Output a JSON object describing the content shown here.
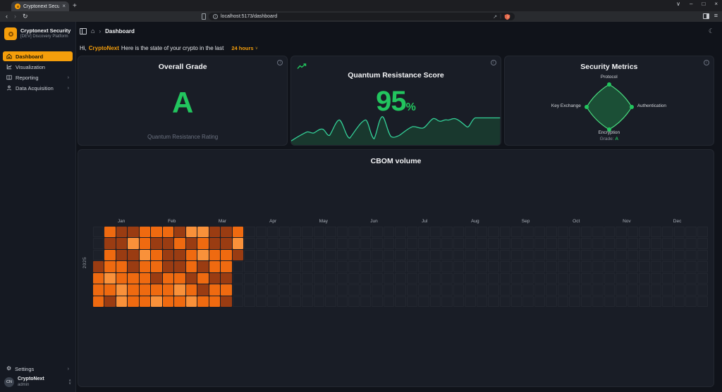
{
  "browser": {
    "tab_title": "Cryptonext Security",
    "url": "localhost:5173/dashboard"
  },
  "icons": {
    "back": "‹",
    "forward": "›",
    "reload": "↻",
    "plus": "+",
    "close": "×",
    "minimize": "–",
    "maximize": "□",
    "window_chevron": "∨",
    "menu": "≡",
    "share": "↗",
    "divider": "|",
    "home": "⌂",
    "breadcrumb_sep": "›",
    "moon": "☾",
    "chevron_right": "›",
    "chevron_down": "∨",
    "chevron_up": "∧",
    "info": "i",
    "gear": "⚙"
  },
  "sidebar": {
    "app_name": "Cryptonext Security",
    "app_subtitle": "[DEV] Discovery Platform",
    "items": [
      {
        "label": "Dashboard",
        "active": true
      },
      {
        "label": "Visualization",
        "active": false
      },
      {
        "label": "Reporting",
        "active": false
      },
      {
        "label": "Data Acquisition",
        "active": false
      }
    ],
    "settings_label": "Settings",
    "user": {
      "initials": "CN",
      "name": "CryptoNext",
      "role": "admin"
    }
  },
  "topbar": {
    "breadcrumb": "Dashboard"
  },
  "greeting": {
    "prefix": "Hi,",
    "username": "CryptoNext",
    "message": "Here is the state of your crypto in the last",
    "range": "24 hours"
  },
  "cards": {
    "overall_grade": {
      "title": "Overall Grade",
      "grade": "A",
      "caption": "Quantum Resistance Rating"
    },
    "quantum_score": {
      "title": "Quantum Resistance Score",
      "value": "95",
      "unit": "%"
    },
    "security_metrics": {
      "title": "Security Metrics",
      "axis_top": "Protocol",
      "axis_right": "Authentication",
      "axis_bottom": "Encryption",
      "axis_left": "Key Exchange",
      "grade_label": "Grade:",
      "grade_value": "A"
    },
    "cbom": {
      "title": "CBOM volume",
      "year_label": "2025"
    }
  },
  "colors": {
    "accent_orange": "#f59e0b",
    "green": "#22c55e",
    "heat_level_1": "#9a3c12",
    "heat_level_2": "#ef6a10",
    "heat_level_3": "#f9913a"
  },
  "chart_data": [
    {
      "type": "area",
      "name": "quantum-resistance-sparkline",
      "title": "Quantum Resistance Score trend",
      "x": [
        0,
        1,
        2,
        3,
        4,
        5,
        6,
        7,
        8,
        9,
        10,
        11,
        12,
        13,
        14,
        15,
        16,
        17,
        18,
        19,
        20
      ],
      "values": [
        12,
        28,
        22,
        38,
        25,
        70,
        15,
        70,
        12,
        80,
        18,
        22,
        50,
        48,
        74,
        68,
        72,
        74,
        55,
        76,
        76
      ],
      "ylim": [
        0,
        100
      ],
      "grid": false,
      "legend": "none"
    },
    {
      "type": "radar",
      "name": "security-metrics-radar",
      "axes": [
        "Protocol",
        "Authentication",
        "Encryption",
        "Key Exchange"
      ],
      "values": [
        100,
        100,
        100,
        100
      ],
      "max": 100,
      "caption": "Grade: A"
    },
    {
      "type": "heatmap",
      "name": "cbom-volume-heatmap",
      "title": "CBOM volume",
      "row_axis_label": "2025",
      "months": [
        "Jan",
        "Feb",
        "Mar",
        "Apr",
        "May",
        "Jun",
        "Jul",
        "Aug",
        "Sep",
        "Oct",
        "Nov",
        "Dec"
      ],
      "weeks_total": 53,
      "rows": 7,
      "levels": {
        "1": "#9a3c12",
        "2": "#ef6a10",
        "3": "#f9913a"
      },
      "matrix": [
        [
          0,
          2,
          1,
          1,
          2,
          2,
          2,
          1,
          3,
          3,
          1,
          1,
          2
        ],
        [
          0,
          1,
          1,
          3,
          2,
          1,
          1,
          2,
          1,
          2,
          1,
          1,
          3
        ],
        [
          0,
          2,
          1,
          1,
          3,
          2,
          1,
          1,
          2,
          3,
          2,
          2,
          1
        ],
        [
          1,
          2,
          2,
          1,
          2,
          2,
          1,
          1,
          2,
          1,
          2,
          2,
          0
        ],
        [
          2,
          3,
          2,
          2,
          2,
          1,
          2,
          2,
          1,
          2,
          1,
          1,
          0
        ],
        [
          2,
          2,
          3,
          2,
          2,
          2,
          2,
          3,
          2,
          1,
          2,
          2,
          0
        ],
        [
          2,
          1,
          3,
          2,
          2,
          3,
          2,
          2,
          3,
          2,
          2,
          1,
          0
        ]
      ]
    }
  ]
}
